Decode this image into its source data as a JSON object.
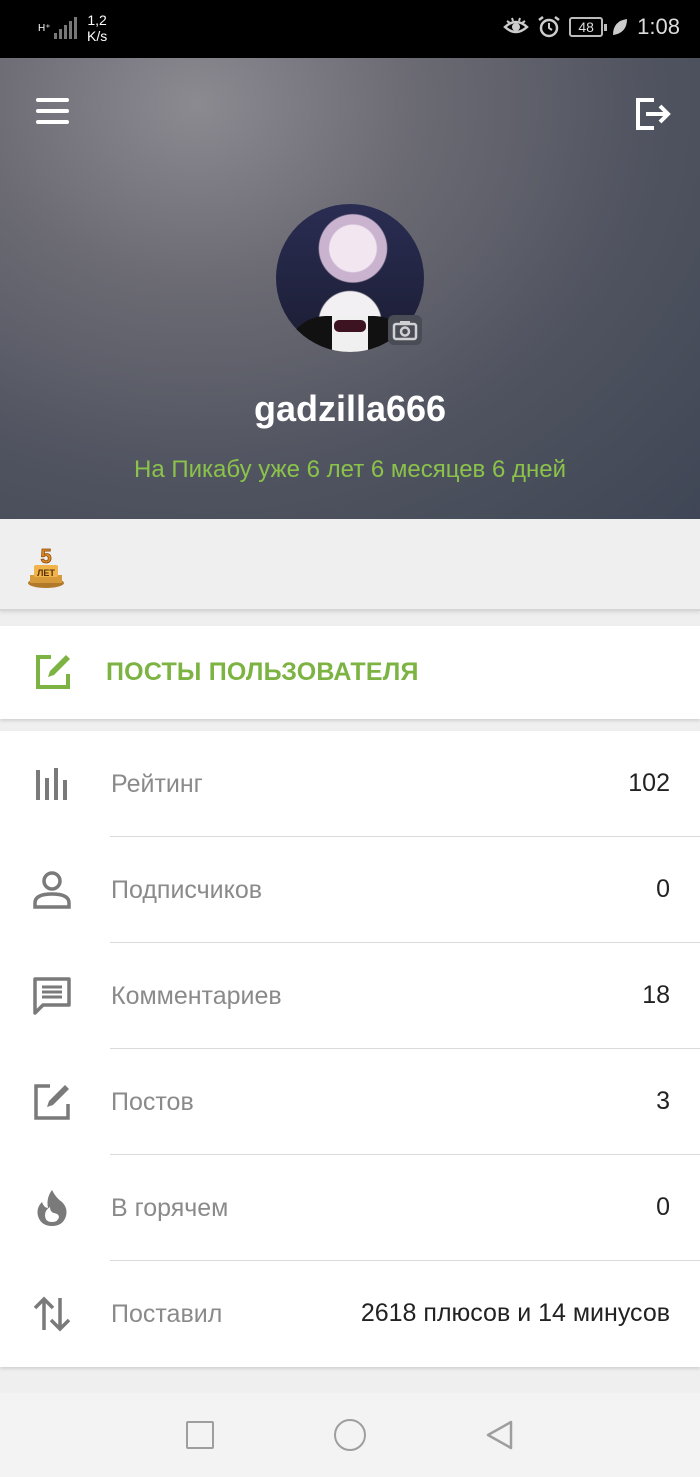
{
  "status_bar": {
    "network_type": "H⁺",
    "speed_value": "1,2",
    "speed_unit": "K/s",
    "battery": "48",
    "time": "1:08",
    "icons": [
      "eye-icon",
      "alarm-icon",
      "battery-icon",
      "leaf-icon"
    ]
  },
  "header": {
    "username": "gadzilla666",
    "since_text": "На Пикабу уже 6 лет 6 месяцев 6 дней"
  },
  "badges": [
    {
      "name": "5-years-badge",
      "number": "5",
      "text": "ЛЕТ"
    }
  ],
  "posts_link": {
    "label": "ПОСТЫ ПОЛЬЗОВАТЕЛЯ"
  },
  "stats": [
    {
      "icon": "rating-bars-icon",
      "label": "Рейтинг",
      "value": "102"
    },
    {
      "icon": "person-icon",
      "label": "Подписчиков",
      "value": "0"
    },
    {
      "icon": "comment-icon",
      "label": "Комментариев",
      "value": "18"
    },
    {
      "icon": "edit-icon",
      "label": "Постов",
      "value": "3"
    },
    {
      "icon": "fire-icon",
      "label": "В горячем",
      "value": "0"
    },
    {
      "icon": "swap-vert-icon",
      "label": "Поставил",
      "value": "2618 плюсов и 14 минусов"
    }
  ],
  "colors": {
    "accent": "#7cb342",
    "since_text": "#8bc34a",
    "label": "#8a8a8a",
    "icon": "#7a7a7a"
  }
}
